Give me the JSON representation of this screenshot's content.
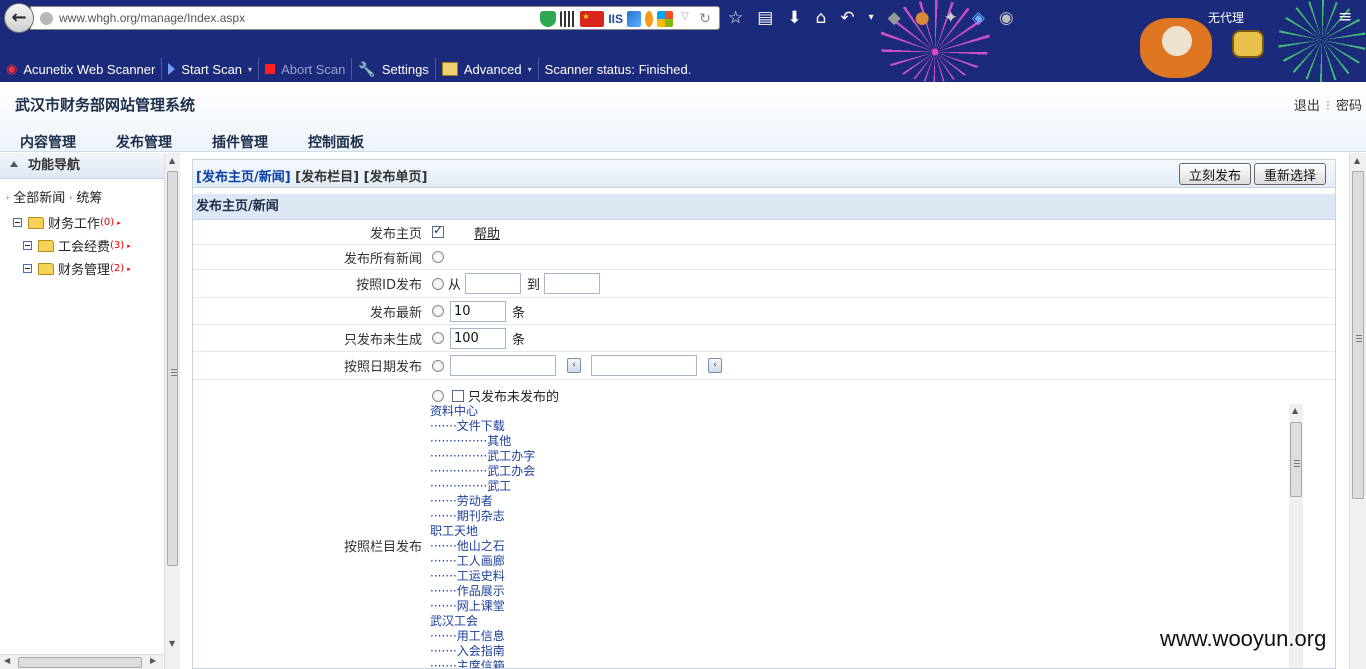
{
  "browser": {
    "url": "www.whgh.org/manage/Index.aspx",
    "iis_label": "IIS",
    "proxy_label": "无代理"
  },
  "scanner_toolbar": {
    "product": "Acunetix Web Scanner",
    "start_scan": "Start Scan",
    "abort_scan": "Abort Scan",
    "settings": "Settings",
    "advanced": "Advanced",
    "status": "Scanner status: Finished."
  },
  "header": {
    "title": "武汉市财务部网站管理系统",
    "logout": "退出",
    "password": "密码",
    "tabs": [
      "内容管理",
      "发布管理",
      "插件管理",
      "控制面板"
    ]
  },
  "sidebar": {
    "title": "功能导航",
    "crumb_all": "全部新闻",
    "crumb_sub": "统筹",
    "tree": [
      {
        "label": "财务工作",
        "count": "(0)"
      },
      {
        "label": "工会经费",
        "count": "(3)"
      },
      {
        "label": "财务管理",
        "count": "(2)"
      }
    ]
  },
  "content": {
    "sub_tabs": [
      "[发布主页/新闻]",
      "[发布栏目]",
      "[发布单页]"
    ],
    "publish_now": "立刻发布",
    "reselect": "重新选择",
    "section_title": "发布主页/新闻",
    "rows": {
      "home": {
        "label": "发布主页",
        "help": "帮助"
      },
      "all_news": {
        "label": "发布所有新闻"
      },
      "by_id": {
        "label": "按照ID发布",
        "from": "从",
        "to": "到"
      },
      "latest": {
        "label": "发布最新",
        "value": "10",
        "unit": "条"
      },
      "ungenerated": {
        "label": "只发布未生成",
        "value": "100",
        "unit": "条"
      },
      "by_date": {
        "label": "按照日期发布"
      },
      "by_column": {
        "label": "按照栏目发布",
        "only_unpublished": "只发布未发布的",
        "items": [
          "资料中心",
          "·······文件下载",
          "···············其他",
          "···············武工办字",
          "···············武工办会",
          "···············武工",
          "·······劳动者",
          "·······期刊杂志",
          "职工天地",
          "·······他山之石",
          "·······工人画廊",
          "·······工运史料",
          "·······作品展示",
          "·······网上课堂",
          "武汉工会",
          "·······用工信息",
          "·······入会指南",
          "·······主席信箱"
        ]
      }
    }
  },
  "watermark": "www.wooyun.org",
  "colors": {
    "chrome_bg": "#1b2a7a",
    "active_tab": "#0a3fa6",
    "count_red": "#ee0000",
    "column_link": "#1b3f9a"
  }
}
